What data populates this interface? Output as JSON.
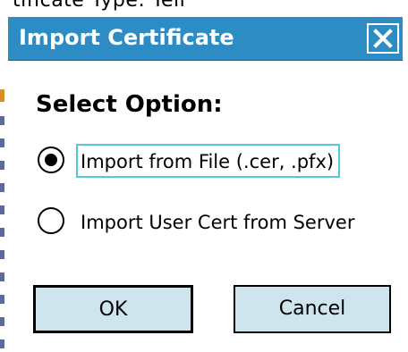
{
  "background": {
    "partial_text": "tificate Type:   Tell"
  },
  "dialog": {
    "title": "Import Certificate",
    "close_icon": "close-icon",
    "heading": "Select Option:",
    "options": [
      {
        "label": "Import from File  (.cer, .pfx)",
        "selected": true
      },
      {
        "label": "Import User Cert from Server",
        "selected": false
      }
    ],
    "ok_label": "OK",
    "cancel_label": "Cancel"
  },
  "colors": {
    "titlebar": "#2d8cc4",
    "button_bg": "#cfe5ee",
    "focus_border": "#55c8d8"
  }
}
